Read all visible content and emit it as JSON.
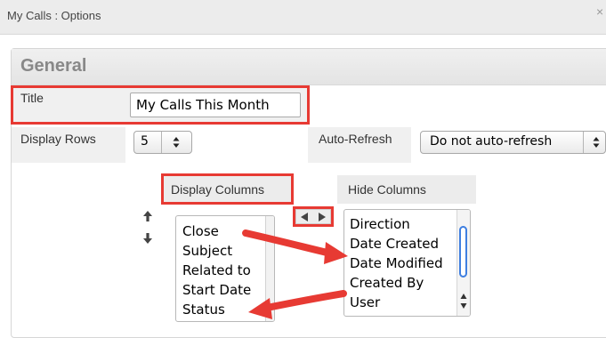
{
  "dialog": {
    "title": "My Calls : Options",
    "close_glyph": "×"
  },
  "section": {
    "heading": "General"
  },
  "form": {
    "title_label": "Title",
    "title_value": "My Calls This Month",
    "display_rows_label": "Display Rows",
    "display_rows_value": "5",
    "auto_refresh_label": "Auto-Refresh",
    "auto_refresh_value": "Do not auto-refresh"
  },
  "columns": {
    "display_header": "Display Columns",
    "hide_header": "Hide Columns",
    "display_items": [
      "Close",
      "Subject",
      "Related to",
      "Start Date",
      "Status"
    ],
    "hide_items": [
      "Direction",
      "Date Created",
      "Date Modified",
      "Created By",
      "User"
    ]
  },
  "icons": {
    "move_up": "arrow-up-icon",
    "move_down": "arrow-down-icon",
    "move_left": "arrow-left-icon",
    "move_right": "arrow-right-icon",
    "select_arrows": "select-updown-icon"
  },
  "colors": {
    "highlight": "#e73a33",
    "scroll_thumb": "#3f7fe0"
  }
}
